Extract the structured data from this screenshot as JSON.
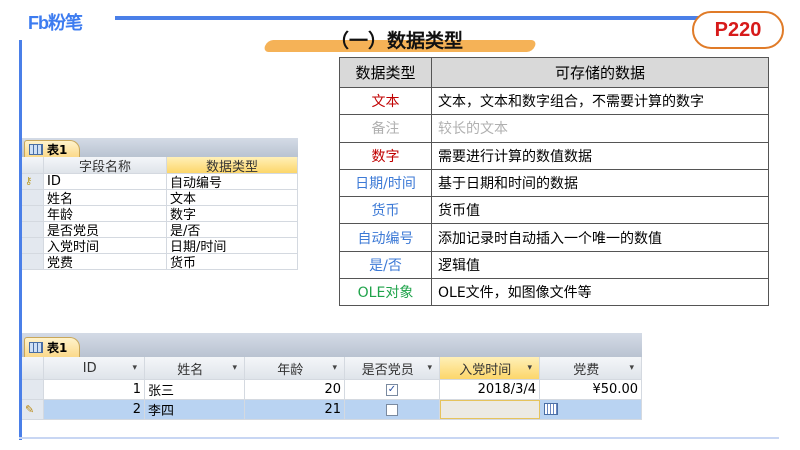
{
  "brand": {
    "logo": "Fb粉笔",
    "page_badge": "P220"
  },
  "title": "（一）数据类型",
  "types_table": {
    "headers": [
      "数据类型",
      "可存储的数据"
    ],
    "rows": [
      {
        "type": "文本",
        "desc": "文本，文本和数字组合，不需要计算的数字",
        "color": "#c00000"
      },
      {
        "type": "备注",
        "desc": "较长的文本",
        "color": "#b0b0b0"
      },
      {
        "type": "数字",
        "desc": "需要进行计算的数值数据",
        "color": "#c00000"
      },
      {
        "type": "日期/时间",
        "desc": "基于日期和时间的数据",
        "color": "#3d7ad6"
      },
      {
        "type": "货币",
        "desc": "货币值",
        "color": "#3d7ad6"
      },
      {
        "type": "自动编号",
        "desc": "添加记录时自动插入一个唯一的数值",
        "color": "#3d7ad6"
      },
      {
        "type": "是/否",
        "desc": "逻辑值",
        "color": "#3d7ad6"
      },
      {
        "type": "OLE对象",
        "desc": "OLE文件，如图像文件等",
        "color": "#1fa34a"
      }
    ]
  },
  "design_view": {
    "tab": "表1",
    "headers": [
      "字段名称",
      "数据类型"
    ],
    "rows": [
      [
        "ID",
        "自动编号"
      ],
      [
        "姓名",
        "文本"
      ],
      [
        "年龄",
        "数字"
      ],
      [
        "是否党员",
        "是/否"
      ],
      [
        "入党时间",
        "日期/时间"
      ],
      [
        "党费",
        "货币"
      ]
    ]
  },
  "datasheet": {
    "tab": "表1",
    "headers": [
      "ID",
      "姓名",
      "年龄",
      "是否党员",
      "入党时间",
      "党费"
    ],
    "rows": [
      {
        "id": "1",
        "name": "张三",
        "age": "20",
        "member": true,
        "date": "2018/3/4",
        "fee": "¥50.00"
      },
      {
        "id": "2",
        "name": "李四",
        "age": "21",
        "member": false,
        "date": "",
        "fee": ""
      }
    ]
  }
}
